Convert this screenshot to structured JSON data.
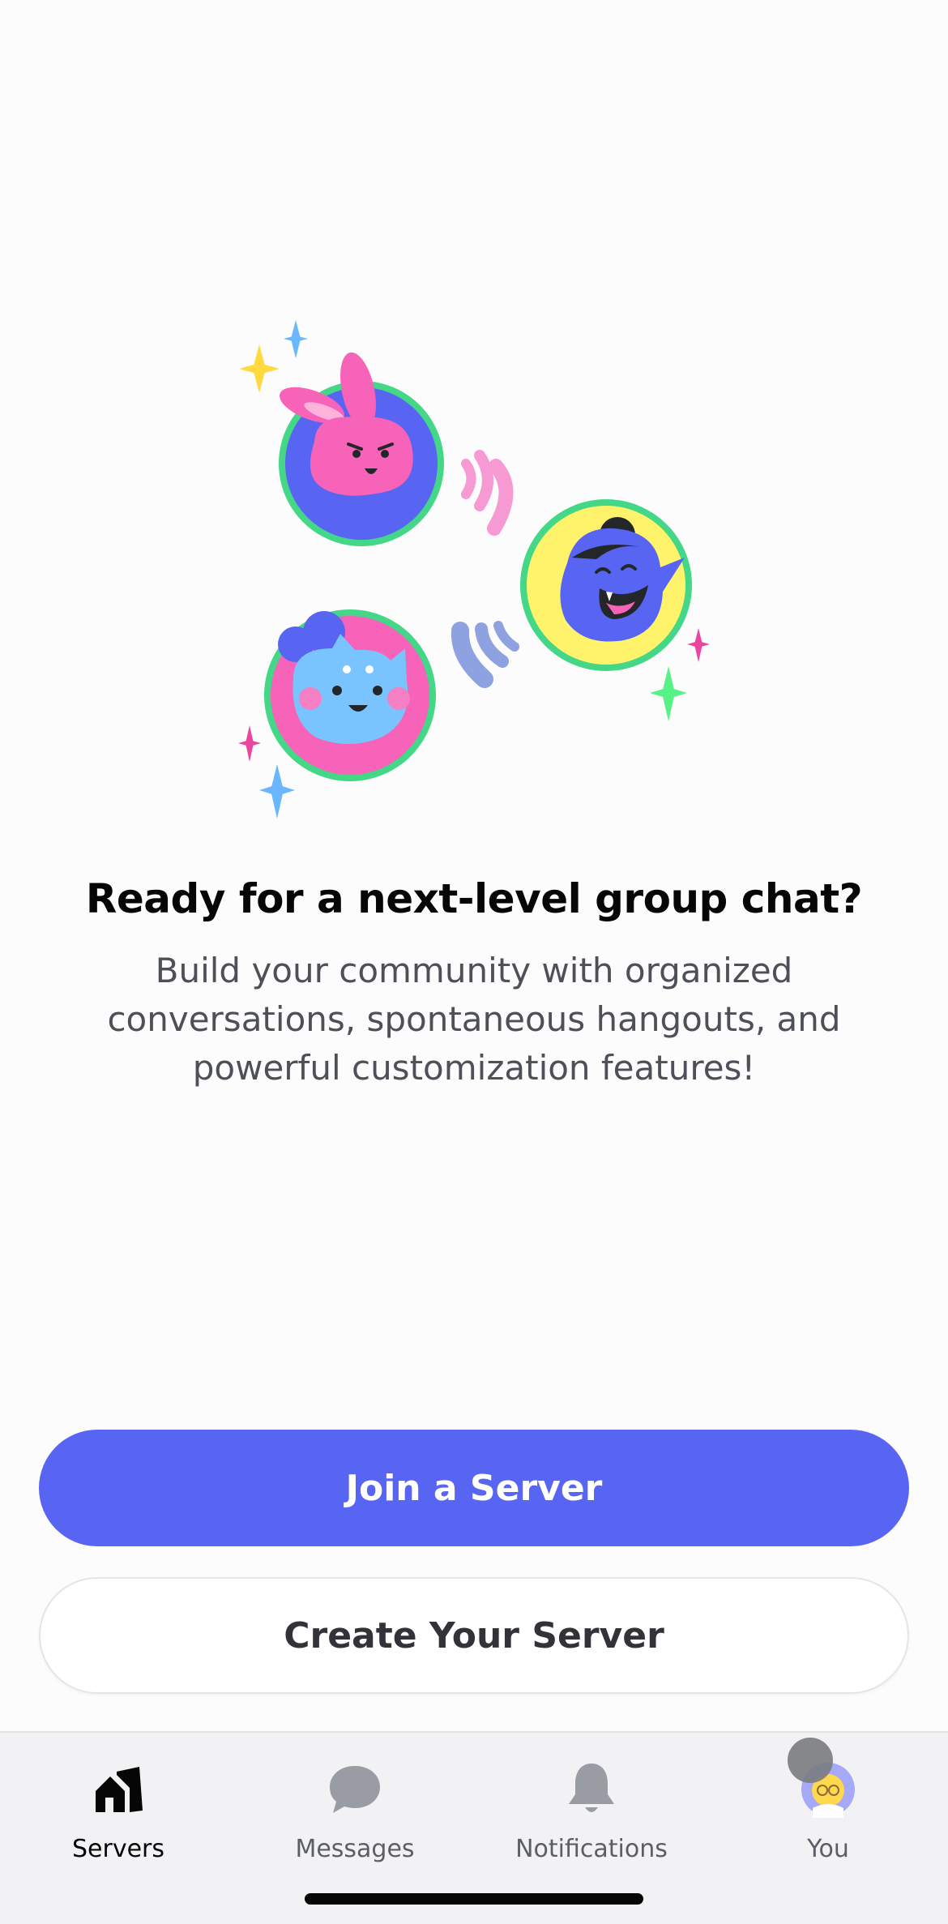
{
  "main": {
    "title": "Ready for a next-level group chat?",
    "subtitle": "Build your community with organized conversations, spontaneous hangouts, and powerful customization features!",
    "join_button": "Join a Server",
    "create_button": "Create Your Server"
  },
  "tabbar": {
    "items": [
      {
        "label": "Servers",
        "icon": "servers-icon",
        "active": true
      },
      {
        "label": "Messages",
        "icon": "messages-icon",
        "active": false
      },
      {
        "label": "Notifications",
        "icon": "bell-icon",
        "active": false
      },
      {
        "label": "You",
        "icon": "avatar",
        "active": false
      }
    ]
  },
  "colors": {
    "brand": "#5865f2",
    "text_primary": "#060607",
    "text_secondary": "#4e5058"
  }
}
